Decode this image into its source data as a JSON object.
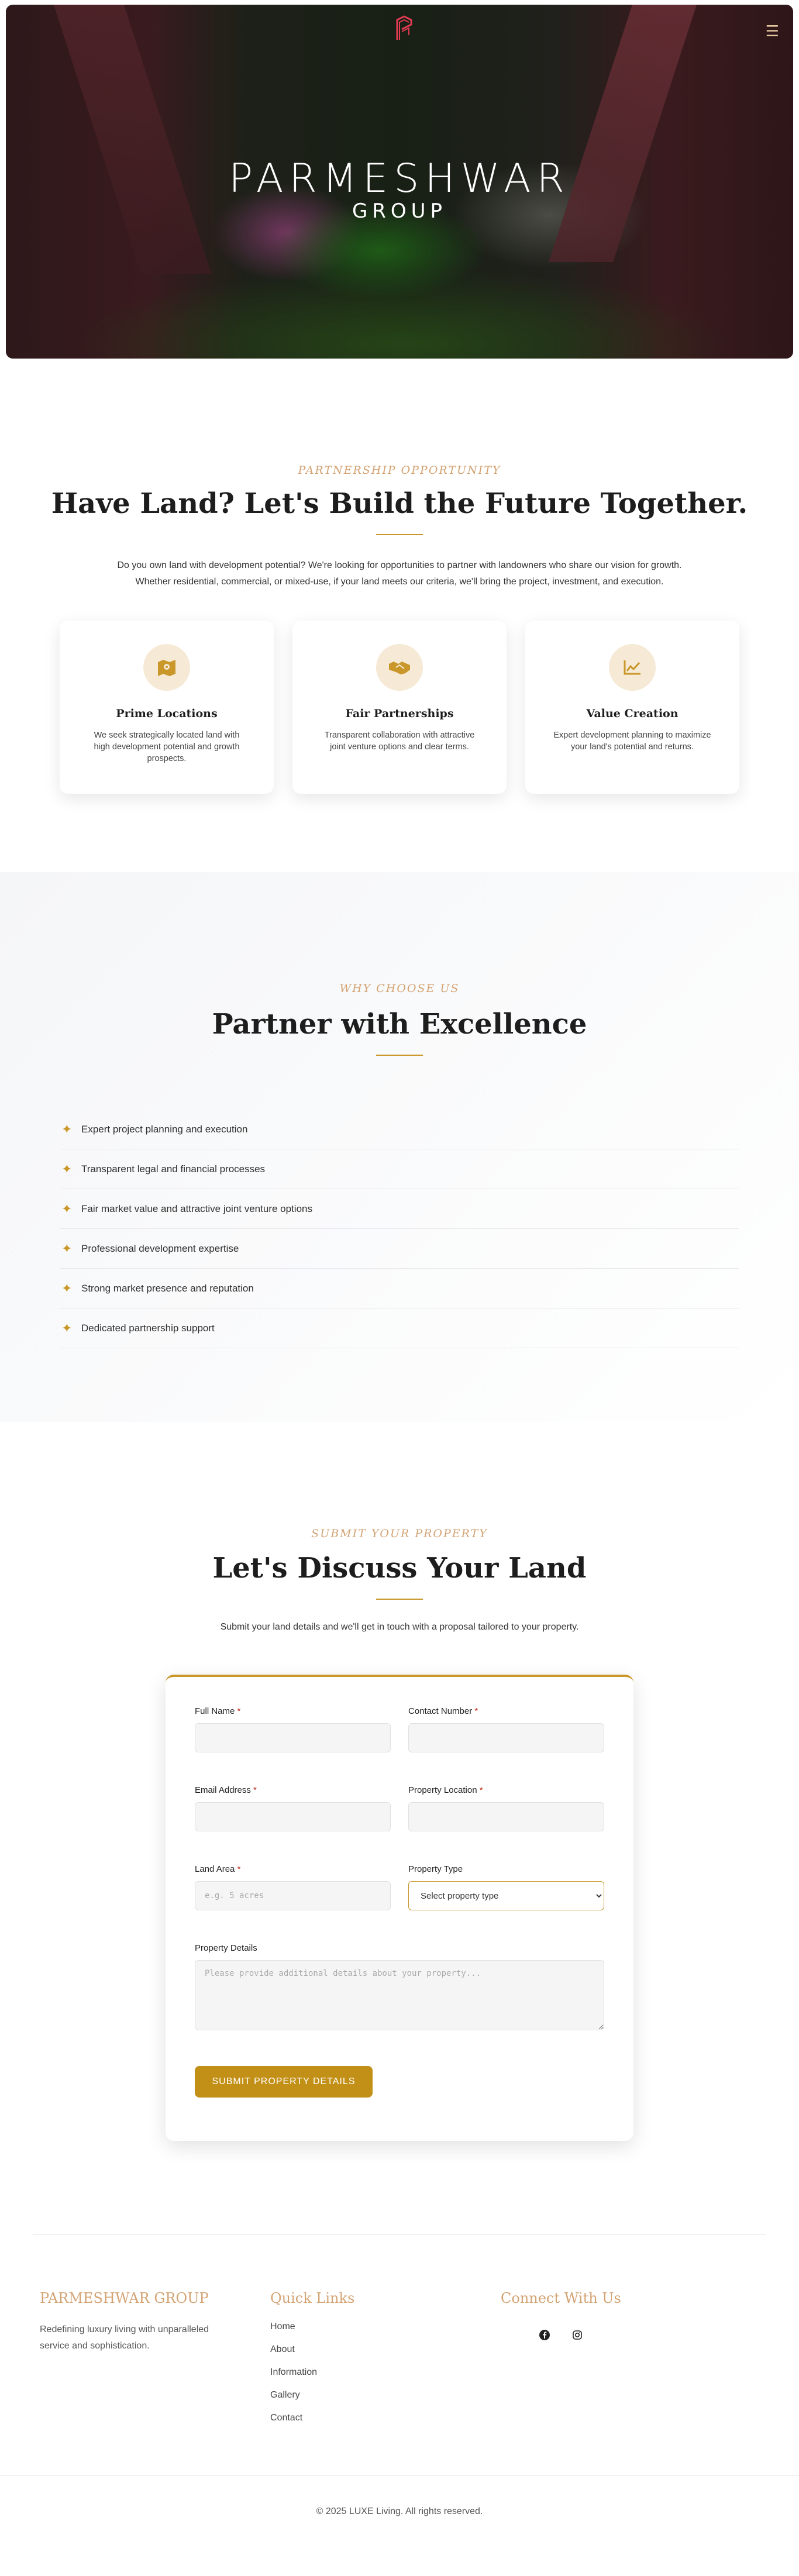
{
  "hero": {
    "brand_name": "PARMESHWAR",
    "brand_sub": "GROUP",
    "menu_glyph": "☰"
  },
  "partnership": {
    "eyebrow": "PARTNERSHIP OPPORTUNITY",
    "heading": "Have Land? Let's Build the Future Together.",
    "intro_line1": "Do you own land with development potential? We're looking for opportunities to partner with landowners who share our vision for growth.",
    "intro_line2": "Whether residential, commercial, or mixed-use, if your land meets our criteria, we'll bring the project, investment, and execution.",
    "cards": [
      {
        "icon": "map-icon",
        "title": "Prime Locations",
        "desc": "We seek strategically located land with high development potential and growth prospects."
      },
      {
        "icon": "handshake-icon",
        "title": "Fair Partnerships",
        "desc": "Transparent collaboration with attractive joint venture options and clear terms."
      },
      {
        "icon": "chart-line-icon",
        "title": "Value Creation",
        "desc": "Expert development planning to maximize your land's potential and returns."
      }
    ]
  },
  "why": {
    "eyebrow": "WHY CHOOSE US",
    "heading": "Partner with Excellence",
    "items": [
      "Expert project planning and execution",
      "Transparent legal and financial processes",
      "Fair market value and attractive joint venture options",
      "Professional development expertise",
      "Strong market presence and reputation",
      "Dedicated partnership support"
    ]
  },
  "contact": {
    "eyebrow": "SUBMIT YOUR PROPERTY",
    "heading": "Let's Discuss Your Land",
    "intro": "Submit your land details and we'll get in touch with a proposal tailored to your property.",
    "fields": {
      "full_name": "Full Name",
      "contact_number": "Contact Number",
      "email": "Email Address",
      "property_location": "Property Location",
      "land_area": "Land Area",
      "land_area_placeholder": "e.g. 5 acres",
      "property_type": "Property Type",
      "property_type_selected": "Select property type",
      "property_details": "Property Details",
      "property_details_placeholder": "Please provide additional details about your property..."
    },
    "required_mark": "*",
    "submit_label": "SUBMIT PROPERTY DETAILS"
  },
  "footer": {
    "brand": "PARMESHWAR GROUP",
    "tagline": "Redefining luxury living with unparalleled service and sophistication.",
    "quick_links_title": "Quick Links",
    "links": [
      "Home",
      "About",
      "Information",
      "Gallery",
      "Contact"
    ],
    "connect_title": "Connect With Us",
    "social": [
      "facebook-icon",
      "instagram-icon"
    ],
    "copyright": "© 2025 LUXE Living. All rights reserved."
  },
  "colors": {
    "gold": "#c9972a",
    "accent_text": "#d4a373",
    "button": "#c39017"
  }
}
